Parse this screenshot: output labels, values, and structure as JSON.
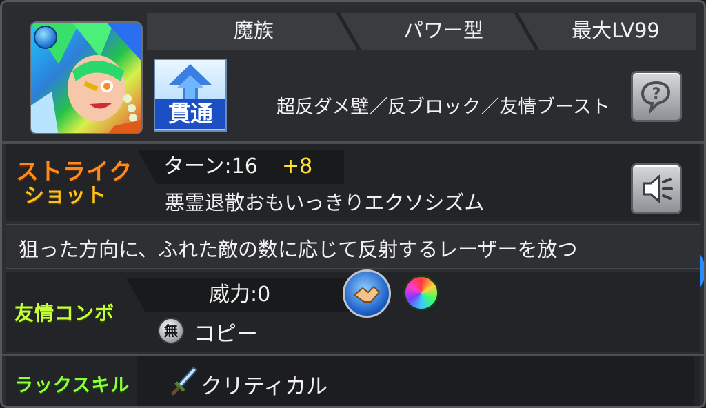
{
  "header": {
    "tribe": "魔族",
    "type": "パワー型",
    "max_level": "最大LV99",
    "gimmicks": "超反ダメ壁／反ブロック／友情ブースト",
    "attack_type_badge": "貫通"
  },
  "strike_shot": {
    "label_line1": "ストライク",
    "label_line2": "ショット",
    "turn_label": "ターン:16",
    "turn_bonus": "+8",
    "name": "悪霊退散おもいっきりエクソシズム",
    "description": "狙った方向に、ふれた敵の数に応じて反射するレーザーを放つ"
  },
  "friendship_combo": {
    "label": "友情コンボ",
    "power": "威力:0",
    "element_badge": "無",
    "name": "コピー"
  },
  "luck_skill": {
    "label": "ラックスキル",
    "name": "クリティカル"
  },
  "colors": {
    "strike_label_top": "#ff8a1c",
    "friendship_label": "#c6ff3a",
    "luck_label": "#8cff3a",
    "turn_bonus": "#ffe23a"
  }
}
